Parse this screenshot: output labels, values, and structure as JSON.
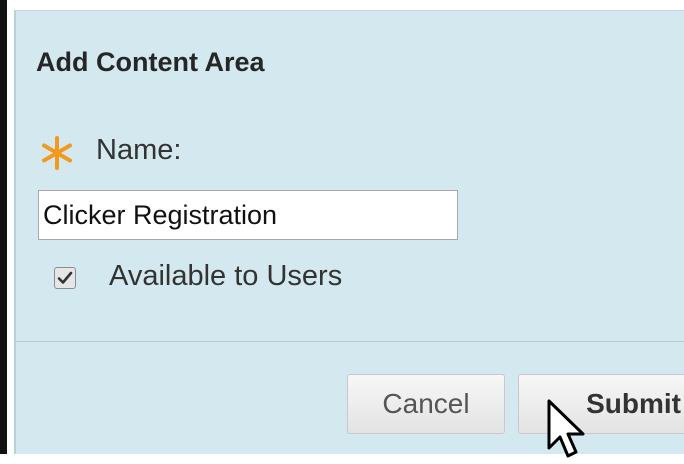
{
  "dialog": {
    "title": "Add Content Area",
    "name_label": "Name:",
    "name_value": "Clicker Registration",
    "availability_label": "Available to Users",
    "availability_checked": true,
    "cancel_label": "Cancel",
    "submit_label": "Submit"
  },
  "icons": {
    "required": "asterisk-icon",
    "checkmark": "checkmark-icon",
    "pointer": "mouse-pointer-icon"
  },
  "colors": {
    "panel_background": "#d3e9ef",
    "required_asterisk": "#f39a1e",
    "text": "#333333"
  }
}
